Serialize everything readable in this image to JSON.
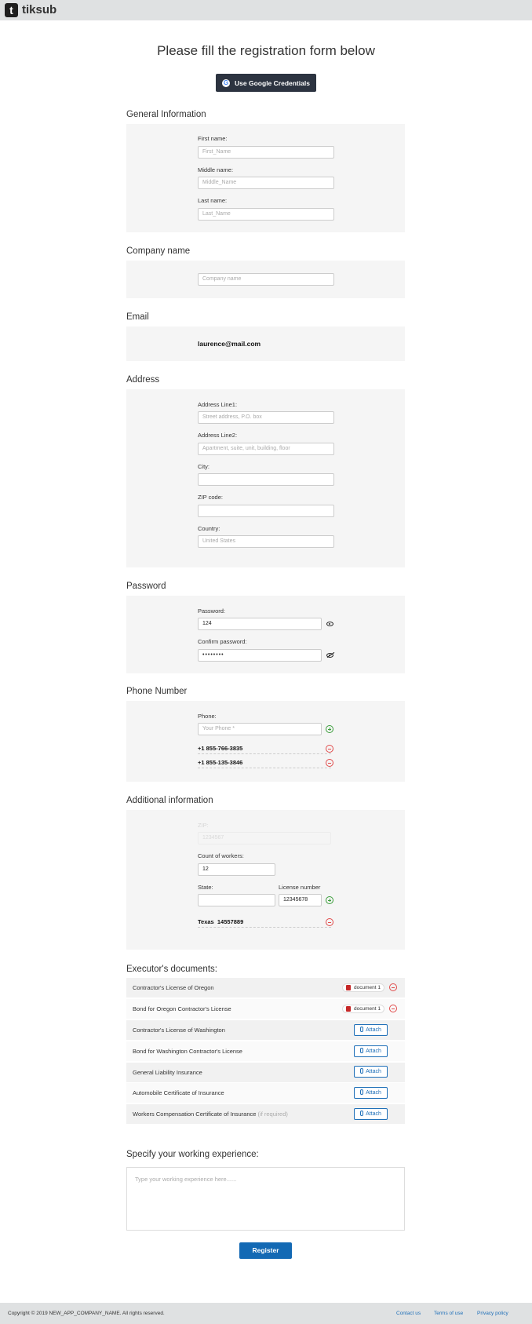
{
  "app": {
    "logo_letter": "t",
    "name": "tiksub"
  },
  "page_title": "Please fill the registration form below",
  "google_button": {
    "label": "Use Google Credentials",
    "icon": "google-icon"
  },
  "general": {
    "title": "General Information",
    "first_name": {
      "label": "First name:",
      "placeholder": "First_Name"
    },
    "middle_name": {
      "label": "Middle name:",
      "placeholder": "Middle_Name"
    },
    "last_name": {
      "label": "Last name:",
      "placeholder": "Last_Name"
    }
  },
  "company": {
    "title": "Company name",
    "placeholder": "Company name"
  },
  "email": {
    "title": "Email",
    "value": "laurence@mail.com"
  },
  "address": {
    "title": "Address",
    "line1": {
      "label": "Address Line1:",
      "placeholder": "Street address, P.O. box"
    },
    "line2": {
      "label": "Address Line2:",
      "placeholder": "Apartment, suite, unit, building, floor"
    },
    "city": {
      "label": "City:",
      "value": ""
    },
    "zip": {
      "label": "ZIP code:",
      "value": ""
    },
    "country": {
      "label": "Country:",
      "placeholder": "United States"
    }
  },
  "password": {
    "title": "Password",
    "password": {
      "label": "Password:",
      "value": "124"
    },
    "confirm": {
      "label": "Confirm password:",
      "value": "••••••••"
    }
  },
  "phone": {
    "title": "Phone Number",
    "label": "Phone:",
    "placeholder": "Your Phone *",
    "numbers": [
      "+1 855-766-3835",
      "+1 855-135-3846"
    ]
  },
  "additional": {
    "title": "Additional information",
    "zip_label": "ZIP:",
    "zip_value": "1234567",
    "workers_label": "Count of workers:",
    "workers_value": "12",
    "state_label": "State:",
    "state_value": "",
    "license_label": "License number",
    "license_value": "12345678",
    "license_entry_state": "Texas",
    "license_entry_number": "14557889"
  },
  "documents": {
    "title": "Executor's documents:",
    "chip_label": "document 1",
    "attach_label": "Attach",
    "items": [
      {
        "name": "Contractor's License of Oregon",
        "note": ""
      },
      {
        "name": "Bond for Oregon Contractor's License",
        "note": ""
      },
      {
        "name": "Contractor's License of Washington",
        "note": ""
      },
      {
        "name": "Bond for Washington Contractor's License",
        "note": ""
      },
      {
        "name": "General Liability Insurance",
        "note": ""
      },
      {
        "name": "Automobile Certificate of  Insurance",
        "note": ""
      },
      {
        "name": "Workers Compensation Certificate of Insurance",
        "note": "(if required)"
      }
    ]
  },
  "experience": {
    "title": "Specify your working experience:",
    "placeholder": "Type your working experience here......"
  },
  "register_label": "Register",
  "footer": {
    "copyright": "Copyright © 2019 NEW_APP_COMPANY_NAME. All rights reserved.",
    "links": [
      "Contact us",
      "Terms of use",
      "Privacy policy"
    ]
  }
}
